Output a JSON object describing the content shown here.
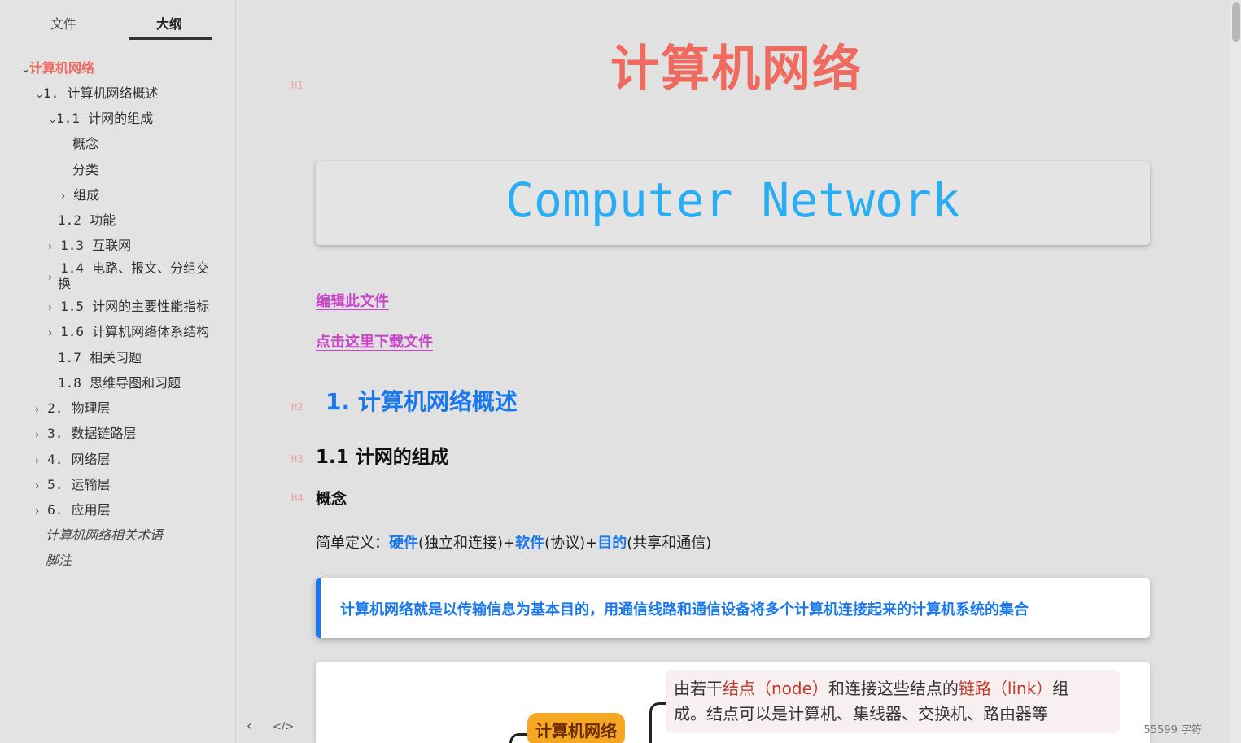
{
  "sidebar": {
    "tabs": {
      "file": "文件",
      "outline": "大纲"
    },
    "outline": [
      {
        "label": "计算机网络"
      },
      {
        "num": "1.",
        "label": "计算机网络概述"
      },
      {
        "num": "1.1",
        "label": "计网的组成"
      },
      {
        "label": "概念"
      },
      {
        "label": "分类"
      },
      {
        "label": "组成"
      },
      {
        "num": "1.2",
        "label": "功能"
      },
      {
        "num": "1.3",
        "label": "互联网"
      },
      {
        "num": "1.4",
        "label": "电路、报文、分组交",
        "label2": "换"
      },
      {
        "num": "1.5",
        "label": "计网的主要性能指标"
      },
      {
        "num": "1.6",
        "label": "计算机网络体系结构"
      },
      {
        "num": "1.7",
        "label": "相关习题"
      },
      {
        "num": "1.8",
        "label": "思维导图和习题"
      },
      {
        "num": "2.",
        "label": "物理层"
      },
      {
        "num": "3.",
        "label": "数据链路层"
      },
      {
        "num": "4.",
        "label": "网络层"
      },
      {
        "num": "5.",
        "label": "运输层"
      },
      {
        "num": "6.",
        "label": "应用层"
      },
      {
        "label": "计算机网络相关术语"
      },
      {
        "label": "脚注"
      }
    ],
    "arrows": {
      "expanded": "⌄",
      "collapsed": "›"
    }
  },
  "footer": {
    "back_icon": "‹",
    "source_icon": "</>",
    "word_count": "55599  字符"
  },
  "doc": {
    "labels": {
      "h1": "H1",
      "h2": "H2",
      "h3": "H3",
      "h4": "H4"
    },
    "h1": "计算机网络",
    "banner": "Computer Network",
    "link_edit": "编辑此文件",
    "link_download": "点击这里下载文件",
    "h2": "1.  计算机网络概述",
    "h3": "1.1  计网的组成",
    "h4": "概念",
    "para": {
      "prefix": "简单定义：",
      "kw1": "硬件",
      "t1": "(独立和连接)+",
      "kw2": "软件",
      "t2": "(协议)+",
      "kw3": "目的",
      "t3": "(共享和通信)"
    },
    "quote": "计算机网络就是以传输信息为基本目的，用通信线路和通信设备将多个计算机连接起来的计算机系统的集合",
    "mindmap": {
      "node": "计算机网络",
      "note_a": "由若干",
      "note_b": "结点（node）",
      "note_c": "和连接这些结点的",
      "note_d": "链路（link）",
      "note_e": "组",
      "note_line2": "成。结点可以是计算机、集线器、交换机、路由器等"
    }
  },
  "colors": {
    "h1": "#ef6b60",
    "banner": "#2aaef3",
    "link": "#cc44cc",
    "accent": "#1a78ee"
  }
}
